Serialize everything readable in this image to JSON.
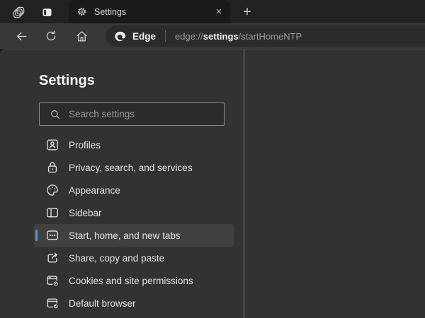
{
  "titlebar": {
    "workspaces_icon": "workspaces-icon",
    "tab_actions_icon": "tab-actions-icon",
    "tab": {
      "title": "Settings",
      "favicon": "gear-icon",
      "close_glyph": "×"
    },
    "new_tab_glyph": "+"
  },
  "toolbar": {
    "back_icon": "back-arrow-icon",
    "refresh_icon": "refresh-icon",
    "home_icon": "home-icon",
    "address": {
      "site_name": "Edge",
      "url_prefix": "edge://",
      "url_highlight": "settings",
      "url_suffix": "/startHomeNTP"
    }
  },
  "settings_page": {
    "heading": "Settings",
    "search": {
      "placeholder": "Search settings",
      "value": ""
    },
    "nav_items": [
      {
        "label": "Profiles",
        "icon": "profiles-icon",
        "selected": false
      },
      {
        "label": "Privacy, search, and services",
        "icon": "privacy-lock-icon",
        "selected": false
      },
      {
        "label": "Appearance",
        "icon": "appearance-palette-icon",
        "selected": false
      },
      {
        "label": "Sidebar",
        "icon": "sidebar-layout-icon",
        "selected": false
      },
      {
        "label": "Start, home, and new tabs",
        "icon": "start-home-tabs-icon",
        "selected": true
      },
      {
        "label": "Share, copy and paste",
        "icon": "share-icon",
        "selected": false
      },
      {
        "label": "Cookies and site permissions",
        "icon": "cookies-permissions-icon",
        "selected": false
      },
      {
        "label": "Default browser",
        "icon": "default-browser-icon",
        "selected": false
      }
    ]
  },
  "colors": {
    "accent_bar": "#5d93c1",
    "toolbar_bg": "#383838",
    "content_bg": "#323232",
    "tabstrip_bg": "#212121",
    "address_bg": "#2b2b2b"
  }
}
